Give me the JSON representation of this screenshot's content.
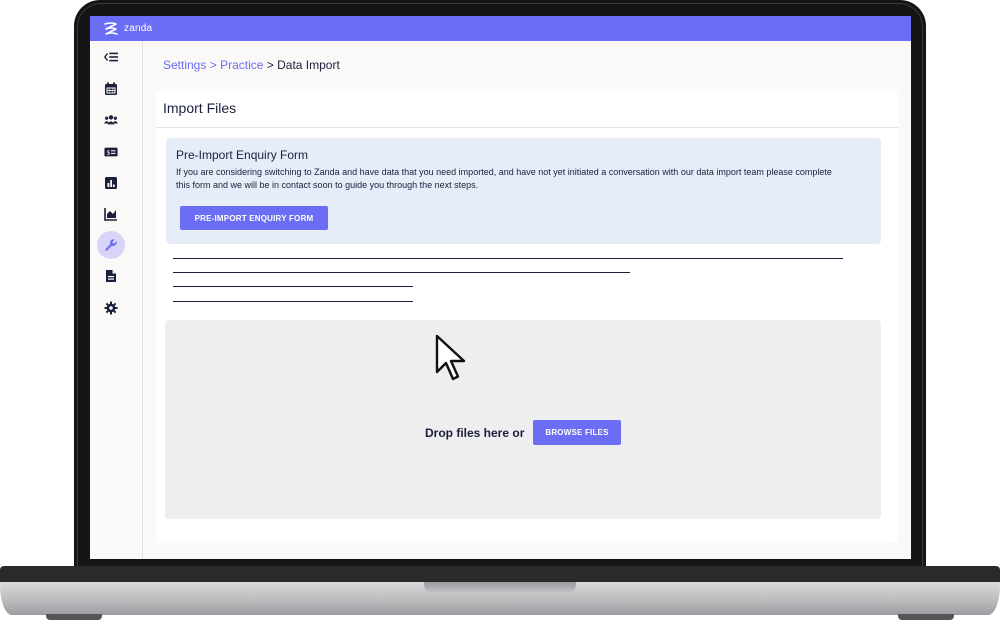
{
  "app": {
    "brand": "zanda",
    "colors": {
      "accent": "#6b6ef5",
      "active_bg": "#d9d3f7",
      "text": "#1b1f3b"
    }
  },
  "sidebar": {
    "items": [
      {
        "icon": "collapse-menu-icon"
      },
      {
        "icon": "calendar-icon"
      },
      {
        "icon": "users-icon"
      },
      {
        "icon": "billing-icon"
      },
      {
        "icon": "reports-icon"
      },
      {
        "icon": "analytics-icon"
      },
      {
        "icon": "wrench-icon",
        "active": true
      },
      {
        "icon": "document-icon"
      },
      {
        "icon": "gear-icon"
      }
    ]
  },
  "breadcrumb": {
    "settings": "Settings",
    "separator": ">",
    "practice": "Practice",
    "current": "Data Import"
  },
  "import_card": {
    "title": "Import Files",
    "enquiry": {
      "title": "Pre-Import Enquiry Form",
      "text": "If you are considering switching to Zanda and have data that you need imported, and have not yet initiated a conversation with our data import team please complete this form and we will be in contact soon to guide you through the next steps.",
      "button_label": "PRE-IMPORT ENQUIRY FORM"
    },
    "dropzone": {
      "label": "Drop files here or",
      "button_label": "BROWSE FILES"
    }
  }
}
